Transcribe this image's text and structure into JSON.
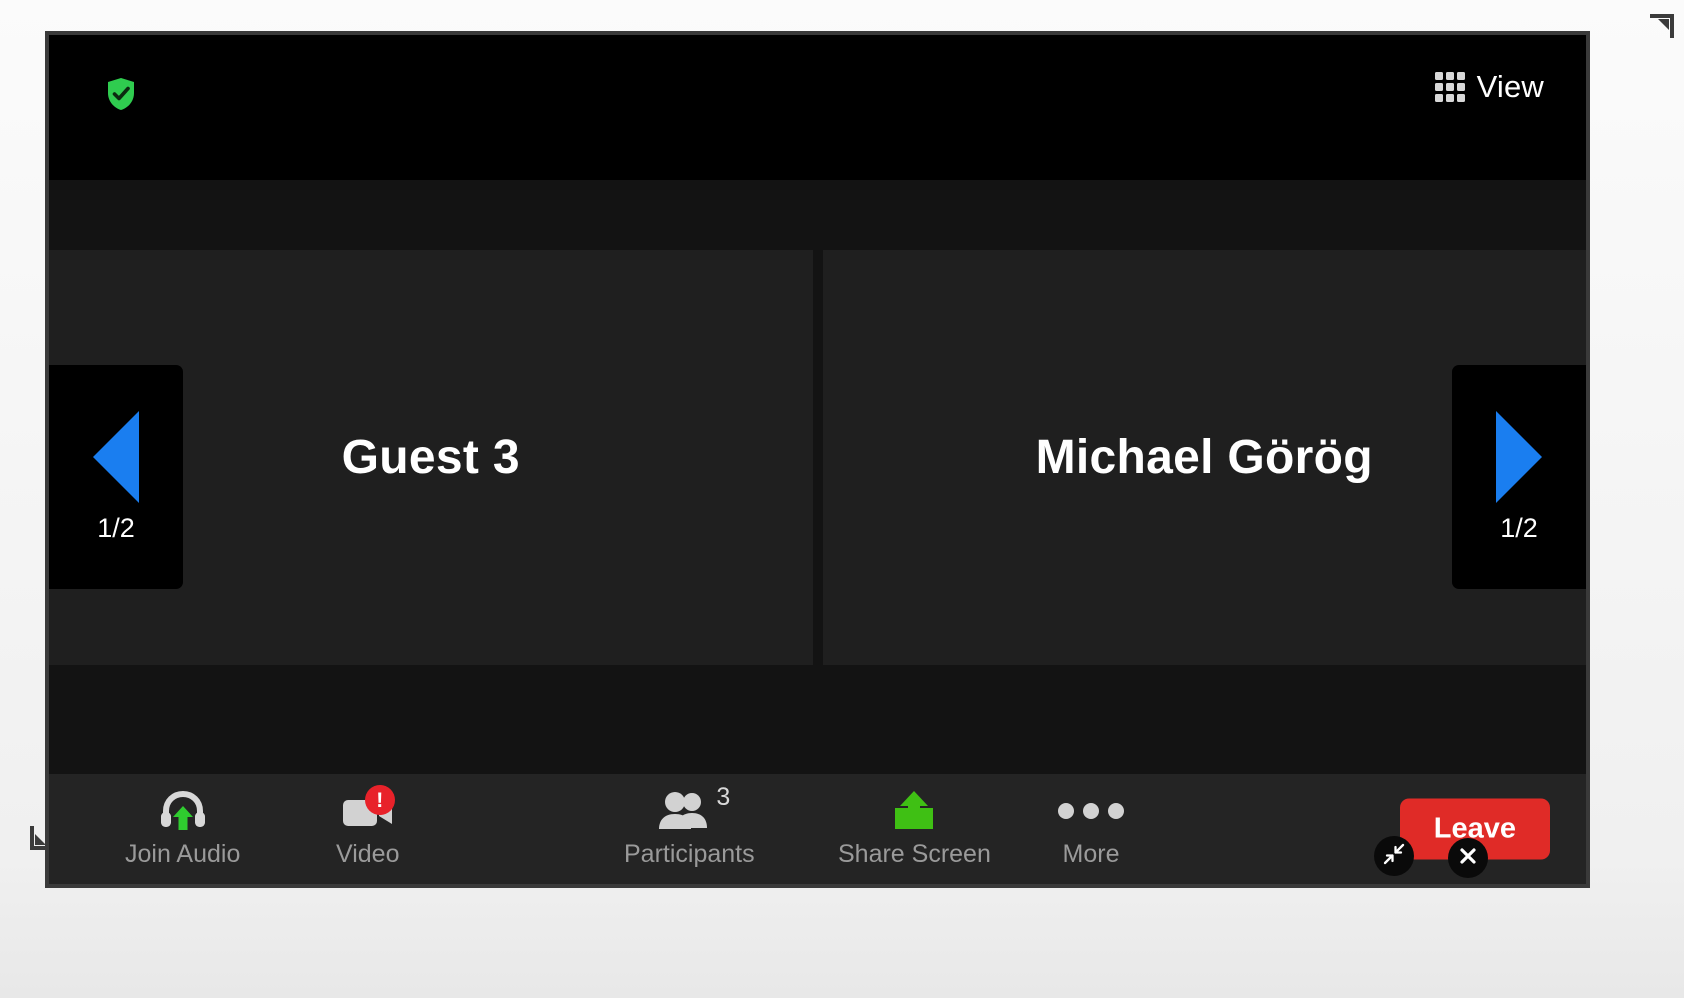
{
  "window": {
    "encryption_icon": "shield-check-icon",
    "view": {
      "icon": "grid-view-icon",
      "label": "View"
    }
  },
  "stage": {
    "tiles": [
      {
        "name": "Guest 3"
      },
      {
        "name": "Michael Görög"
      }
    ],
    "nav": {
      "prev": {
        "icon": "triangle-left-icon",
        "page_indicator": "1/2"
      },
      "next": {
        "icon": "triangle-right-icon",
        "page_indicator": "1/2"
      }
    }
  },
  "toolbar": {
    "join_audio": {
      "icon": "headset-up-arrow-icon",
      "label": "Join Audio"
    },
    "video": {
      "icon": "camera-icon",
      "label": "Video",
      "badge": "!"
    },
    "participants": {
      "icon": "people-icon",
      "label": "Participants",
      "count": "3"
    },
    "share_screen": {
      "icon": "share-screen-up-arrow-icon",
      "label": "Share Screen"
    },
    "more": {
      "icon": "ellipsis-icon",
      "label": "More"
    },
    "leave": {
      "label": "Leave"
    }
  },
  "floating_controls": {
    "minimize": {
      "icon": "collapse-arrows-icon"
    },
    "close": {
      "icon": "close-x-icon"
    }
  },
  "colors": {
    "accent_blue": "#1a7ef0",
    "leave_red": "#e02b27",
    "share_green": "#3fc014",
    "shield_green": "#2fcc4f",
    "alert_red": "#e8222a"
  }
}
